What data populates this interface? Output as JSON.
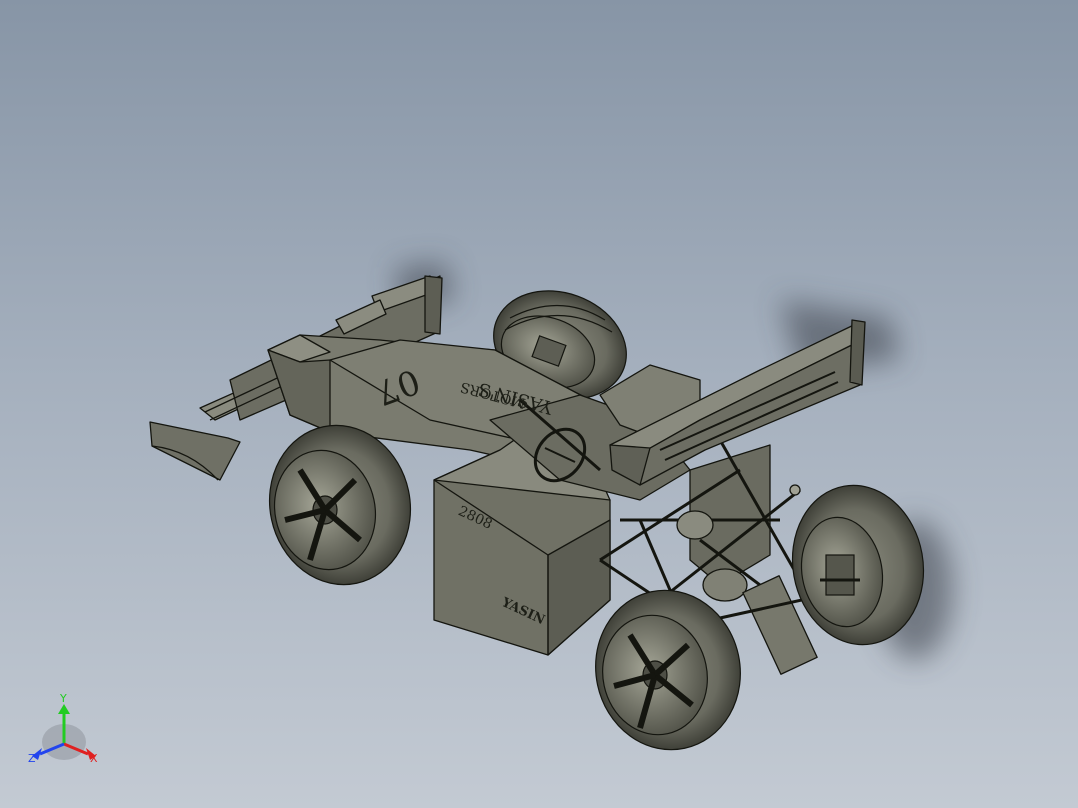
{
  "viewport": {
    "background_top": "#8795a6",
    "background_bottom": "#c3cad3",
    "model_color": "#75766a",
    "edge_color": "#14150f"
  },
  "model": {
    "decals": {
      "number": "07",
      "brand_line1": "YASIN'S",
      "brand_line2": "MOTORS",
      "side_code": "2808",
      "front_badge": "YASIN"
    }
  },
  "triad": {
    "x_label": "X",
    "y_label": "Y",
    "z_label": "Z",
    "x_color": "#e02020",
    "y_color": "#22cc22",
    "z_color": "#2244ee"
  }
}
